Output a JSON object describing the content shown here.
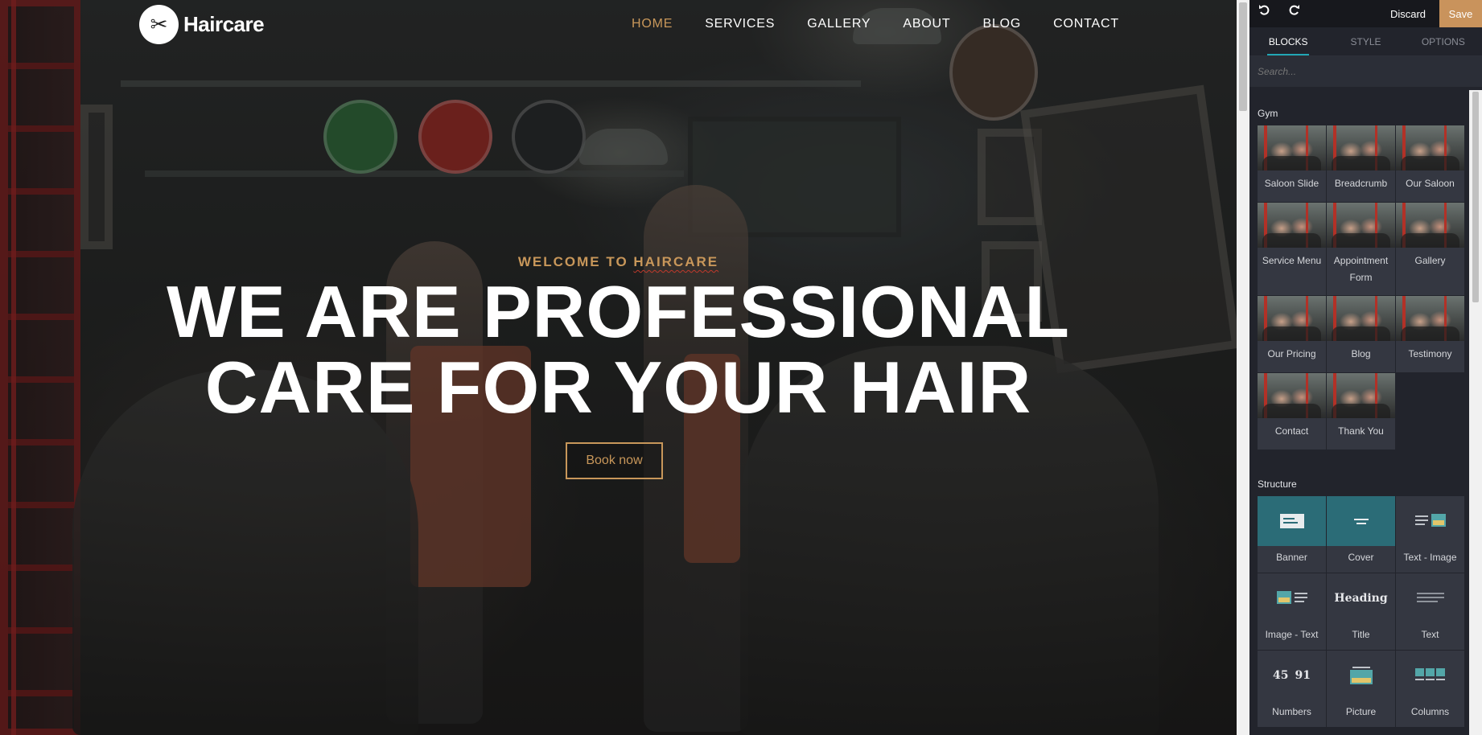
{
  "site": {
    "brand": "Haircare",
    "nav": [
      "HOME",
      "SERVICES",
      "GALLERY",
      "ABOUT",
      "BLOG",
      "CONTACT"
    ],
    "active_nav": "HOME",
    "hero": {
      "eyebrow_prefix": "WELCOME TO ",
      "eyebrow_brand": "HAIRCARE",
      "line1": "WE ARE PROFESSIONAL",
      "line2": "CARE FOR YOUR HAIR",
      "cta": "Book now"
    }
  },
  "editor": {
    "toolbar": {
      "discard": "Discard",
      "save": "Save",
      "undo_icon": "undo-icon",
      "redo_icon": "redo-icon"
    },
    "tabs": [
      "BLOCKS",
      "STYLE",
      "OPTIONS"
    ],
    "active_tab": "BLOCKS",
    "search_placeholder": "Search...",
    "groups": [
      {
        "title": "Gym",
        "items": [
          "Saloon Slide",
          "Breadcrumb",
          "Our Saloon",
          "Service Menu",
          "Appointment Form",
          "Gallery",
          "Our Pricing",
          "Blog",
          "Testimony",
          "Contact",
          "Thank You"
        ]
      },
      {
        "title": "Structure",
        "items": [
          "Banner",
          "Cover",
          "Text - Image",
          "Image - Text",
          "Title",
          "Text",
          "Numbers",
          "Picture",
          "Columns"
        ]
      }
    ],
    "structure_icons": {
      "title_word": "Heading",
      "numbers": [
        "45",
        "91"
      ]
    },
    "colors": {
      "accent": "#c9935c",
      "tab_underline": "#22a7b5",
      "panel_bg": "#22242c"
    }
  }
}
